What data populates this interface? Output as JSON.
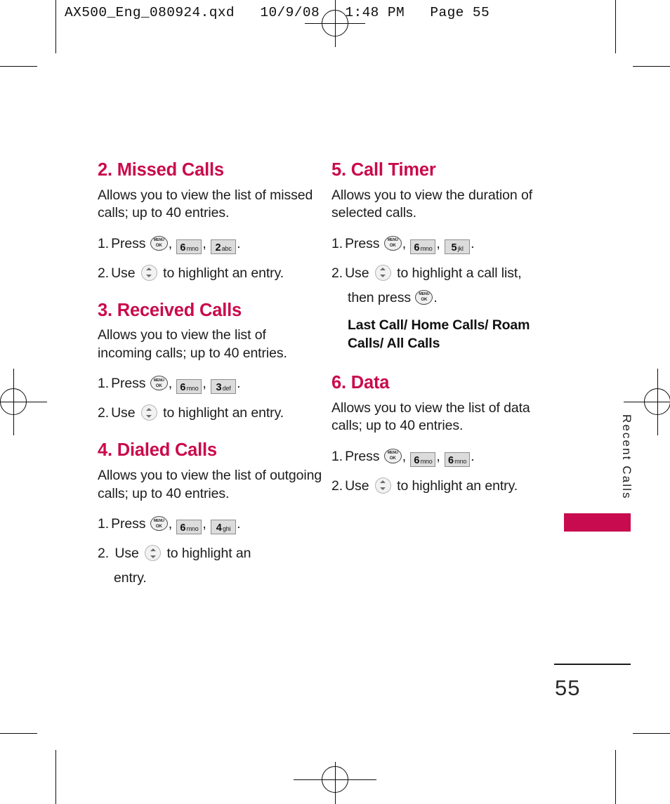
{
  "file_header": "AX500_Eng_080924.qxd   10/9/08   1:48 PM   Page 55",
  "colors": {
    "heading_crimson": "#ca0a4b",
    "tab_crimson": "#c80b4e",
    "body_text": "#1c1c1c",
    "key_face": "#dcdcdc",
    "key_border": "#8d8d8d"
  },
  "icons": {
    "menu_ok": {
      "top": "MENU",
      "bottom": "OK",
      "name": "menu-ok-key-icon"
    },
    "nav": {
      "name": "navigation-updown-key-icon"
    }
  },
  "sections": [
    {
      "title": "2. Missed Calls",
      "desc": "Allows you to view the list of missed calls; up to 40 entries.",
      "steps": [
        {
          "num": "1.",
          "verb": "Press",
          "keys": [
            {
              "type": "menu"
            },
            {
              "type": "num",
              "digit": "6",
              "letters": "mno"
            },
            {
              "type": "num",
              "digit": "2",
              "letters": "abc"
            }
          ],
          "tail": "."
        },
        {
          "num": "2.",
          "verb": "Use",
          "keys": [
            {
              "type": "nav"
            }
          ],
          "tail": "to highlight an entry."
        }
      ]
    },
    {
      "title": "3. Received Calls",
      "desc": "Allows you to view the list of incoming calls; up to 40 entries.",
      "steps": [
        {
          "num": "1.",
          "verb": "Press",
          "keys": [
            {
              "type": "menu"
            },
            {
              "type": "num",
              "digit": "6",
              "letters": "mno"
            },
            {
              "type": "num",
              "digit": "3",
              "letters": "def"
            }
          ],
          "tail": "."
        },
        {
          "num": "2.",
          "verb": "Use",
          "keys": [
            {
              "type": "nav"
            }
          ],
          "tail": "to highlight an entry."
        }
      ]
    },
    {
      "title": "4. Dialed Calls",
      "desc": "Allows you to view the list of outgoing calls; up to 40 entries.",
      "steps": [
        {
          "num": "1.",
          "verb": "Press",
          "keys": [
            {
              "type": "menu"
            },
            {
              "type": "num",
              "digit": "6",
              "letters": "mno"
            },
            {
              "type": "num",
              "digit": "4",
              "letters": "ghi"
            }
          ],
          "tail": "."
        },
        {
          "num": "2.",
          "verb": "Use",
          "keys": [
            {
              "type": "nav"
            }
          ],
          "tail": "to highlight an",
          "cont": "entry."
        }
      ]
    },
    {
      "title": "5. Call Timer",
      "desc": "Allows you to view the duration of selected calls.",
      "steps": [
        {
          "num": "1.",
          "verb": "Press",
          "keys": [
            {
              "type": "menu"
            },
            {
              "type": "num",
              "digit": "6",
              "letters": "mno"
            },
            {
              "type": "num",
              "digit": "5",
              "letters": "jkl"
            }
          ],
          "tail": "."
        },
        {
          "num": "2.",
          "verb": "Use",
          "keys": [
            {
              "type": "nav"
            }
          ],
          "tail": "to highlight a call list,",
          "cont_prefix": "then press",
          "cont_keys": [
            {
              "type": "menu"
            }
          ],
          "cont_suffix": "."
        }
      ],
      "bold_list": "Last Call/ Home Calls/ Roam Calls/ All Calls"
    },
    {
      "title": "6. Data",
      "desc": "Allows you to view the list of data calls; up to 40 entries.",
      "steps": [
        {
          "num": "1.",
          "verb": "Press",
          "keys": [
            {
              "type": "menu"
            },
            {
              "type": "num",
              "digit": "6",
              "letters": "mno"
            },
            {
              "type": "num",
              "digit": "6",
              "letters": "mno"
            }
          ],
          "tail": "."
        },
        {
          "num": "2.",
          "verb": "Use",
          "keys": [
            {
              "type": "nav"
            }
          ],
          "tail": "to highlight an entry."
        }
      ]
    }
  ],
  "side_tab": {
    "label": "Recent Calls"
  },
  "folio": {
    "page_number": "55"
  }
}
